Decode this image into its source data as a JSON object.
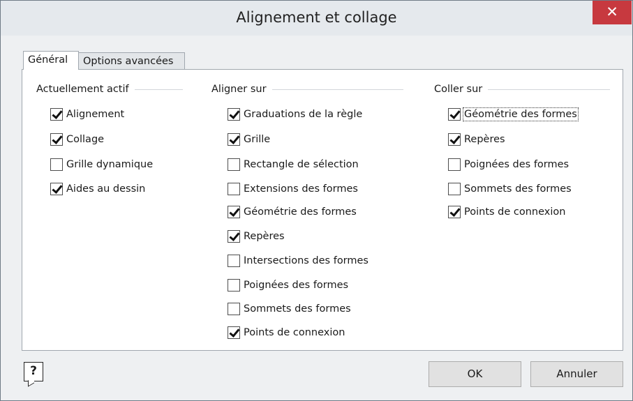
{
  "window": {
    "title": "Alignement et collage",
    "close_label": "✕"
  },
  "tabs": [
    {
      "label": "Général",
      "selected": true
    },
    {
      "label": "Options avancées",
      "selected": false
    }
  ],
  "groups": {
    "active": {
      "title": "Actuellement actif",
      "items": [
        {
          "label": "Alignement",
          "checked": true
        },
        {
          "label": "Collage",
          "checked": true
        },
        {
          "label": "Grille dynamique",
          "checked": false
        },
        {
          "label": "Aides au dessin",
          "checked": true
        }
      ]
    },
    "snap_to": {
      "title": "Aligner sur",
      "items": [
        {
          "label": "Graduations de la règle",
          "checked": true
        },
        {
          "label": "Grille",
          "checked": true
        },
        {
          "label": "Rectangle de sélection",
          "checked": false
        },
        {
          "label": "Extensions des formes",
          "checked": false
        },
        {
          "label": "Géométrie des formes",
          "checked": true
        },
        {
          "label": "Repères",
          "checked": true
        },
        {
          "label": "Intersections des formes",
          "checked": false
        },
        {
          "label": "Poignées des formes",
          "checked": false
        },
        {
          "label": "Sommets des formes",
          "checked": false
        },
        {
          "label": "Points de connexion",
          "checked": true
        }
      ]
    },
    "glue_to": {
      "title": "Coller sur",
      "items": [
        {
          "label": "Géométrie des formes",
          "checked": true
        },
        {
          "label": "Repères",
          "checked": true
        },
        {
          "label": "Poignées des formes",
          "checked": false
        },
        {
          "label": "Sommets des formes",
          "checked": false
        },
        {
          "label": "Points de connexion",
          "checked": true
        }
      ]
    }
  },
  "buttons": {
    "help_label": "?",
    "ok_label": "OK",
    "cancel_label": "Annuler"
  }
}
